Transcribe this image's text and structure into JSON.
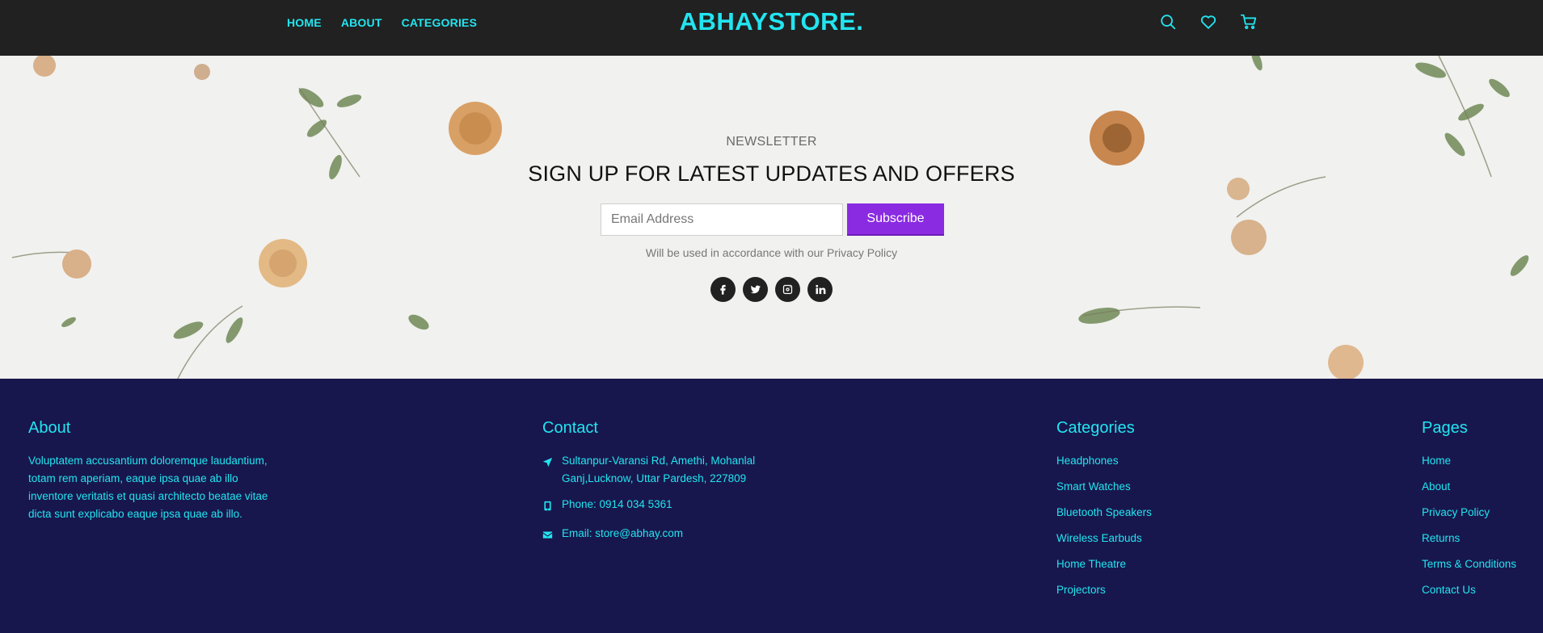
{
  "header": {
    "nav": [
      "HOME",
      "ABOUT",
      "CATEGORIES"
    ],
    "logo": "ABHAYSTORE.",
    "icons": [
      "search-icon",
      "heart-icon",
      "cart-icon"
    ]
  },
  "newsletter": {
    "kicker": "NEWSLETTER",
    "title": "SIGN UP FOR LATEST UPDATES AND OFFERS",
    "email_placeholder": "Email Address",
    "subscribe_label": "Subscribe",
    "note": "Will be used in accordance with our Privacy Policy",
    "social": [
      "facebook-icon",
      "twitter-icon",
      "instagram-icon",
      "linkedin-icon"
    ]
  },
  "footer": {
    "about": {
      "title": "About",
      "text": "Voluptatem accusantium doloremque laudantium, totam rem aperiam, eaque ipsa quae ab illo inventore veritatis et quasi architecto beatae vitae dicta sunt explicabo eaque ipsa quae ab illo."
    },
    "contact": {
      "title": "Contact",
      "address": "Sultanpur-Varansi Rd, Amethi, Mohanlal Ganj,Lucknow, Uttar Pardesh, 227809",
      "phone": "Phone: 0914 034 5361",
      "email": "Email: store@abhay.com"
    },
    "categories": {
      "title": "Categories",
      "items": [
        "Headphones",
        "Smart Watches",
        "Bluetooth Speakers",
        "Wireless Earbuds",
        "Home Theatre",
        "Projectors"
      ]
    },
    "pages": {
      "title": "Pages",
      "items": [
        "Home",
        "About",
        "Privacy Policy",
        "Returns",
        "Terms & Conditions",
        "Contact Us"
      ]
    }
  },
  "colors": {
    "accent": "#22e5f0",
    "header_bg": "#212121",
    "footer_bg": "#18174d",
    "button": "#8a2be2"
  }
}
